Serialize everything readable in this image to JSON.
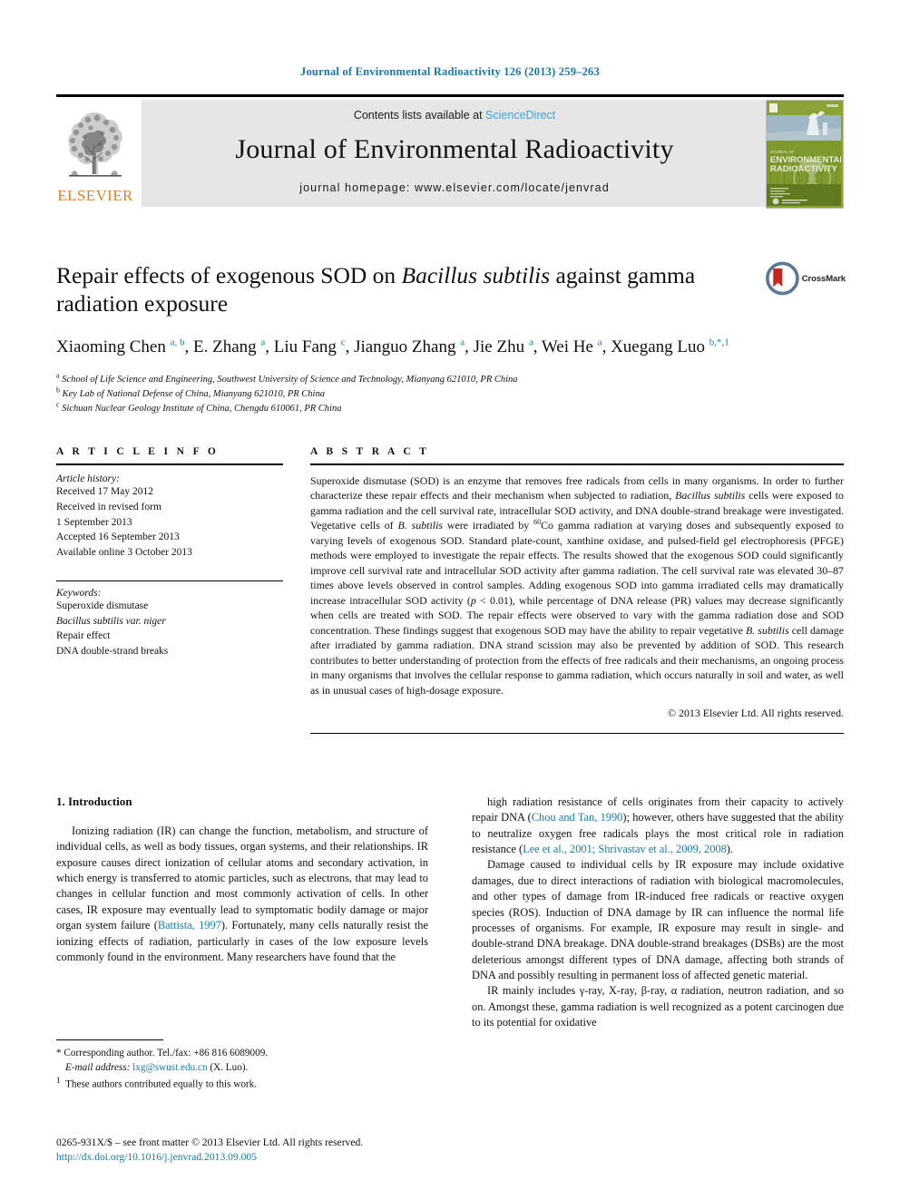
{
  "running_head": "Journal of Environmental Radioactivity 126 (2013) 259–263",
  "masthead": {
    "publisher_name": "ELSEVIER",
    "contents_prefix": "Contents lists available at",
    "contents_link": "ScienceDirect",
    "journal_title": "Journal of Environmental Radioactivity",
    "homepage": "journal homepage: www.elsevier.com/locate/jenvrad",
    "cover_title_line1": "JOURNAL OF",
    "cover_title_line2": "ENVIRONMENTAL",
    "cover_title_line3": "RADIOACTIVITY"
  },
  "badge": {
    "crossmark_label": "CrossMark"
  },
  "article": {
    "title_part1": "Repair effects of exogenous SOD on ",
    "title_italic": "Bacillus subtilis",
    "title_part2": " against gamma radiation exposure",
    "authors_html": "Xiaoming Chen <sup>a, b</sup>, E. Zhang <sup>a</sup>, Liu Fang <sup>c</sup>, Jianguo Zhang <sup>a</sup>, Jie Zhu <sup>a</sup>, Wei He <sup>a</sup>, Xuegang Luo <sup>b,&#42;,1</sup>",
    "affiliations": [
      "School of Life Science and Engineering, Southwest University of Science and Technology, Mianyang 621010, PR China",
      "Key Lab of National Defense of China, Mianyang 621010, PR China",
      "Sichuan Nuclear Geology Institute of China, Chengdu 610061, PR China"
    ],
    "affiliation_marks": [
      "a",
      "b",
      "c"
    ]
  },
  "article_info": {
    "heading": "A R T I C L E   I N F O",
    "history_label": "Article history:",
    "history": [
      "Received 17 May 2012",
      "Received in revised form",
      "1 September 2013",
      "Accepted 16 September 2013",
      "Available online 3 October 2013"
    ],
    "keywords_label": "Keywords:",
    "keywords": [
      "Superoxide dismutase",
      "Bacillus subtilis var. niger",
      "Repair effect",
      "DNA double-strand breaks"
    ]
  },
  "abstract": {
    "heading": "A B S T R A C T",
    "text_html": "Superoxide dismutase (SOD) is an enzyme that removes free radicals from cells in many organisms. In order to further characterize these repair effects and their mechanism when subjected to radiation, <i>Bacillus subtilis</i> cells were exposed to gamma radiation and the cell survival rate, intracellular SOD activity, and DNA double-strand breakage were investigated. Vegetative cells of <i>B. subtilis</i> were irradiated by <sup>60</sup>Co gamma radiation at varying doses and subsequently exposed to varying levels of exogenous SOD. Standard plate-count, xanthine oxidase, and pulsed-field gel electrophoresis (PFGE) methods were employed to investigate the repair effects. The results showed that the exogenous SOD could significantly improve cell survival rate and intracellular SOD activity after gamma radiation. The cell survival rate was elevated 30&#8211;87 times above levels observed in control samples. Adding exogenous SOD into gamma irradiated cells may dramatically increase intracellular SOD activity (<i>p</i> &lt; 0.01), while percentage of DNA release (PR) values may decrease significantly when cells are treated with SOD. The repair effects were observed to vary with the gamma radiation dose and SOD concentration. These findings suggest that exogenous SOD may have the ability to repair vegetative <i>B. subtilis</i> cell damage after irradiated by gamma radiation. DNA strand scission may also be prevented by addition of SOD. This research contributes to better understanding of protection from the effects of free radicals and their mechanisms, an ongoing process in many organisms that involves the cellular response to gamma radiation, which occurs naturally in soil and water, as well as in unusual cases of high-dosage exposure.",
    "copyright": "© 2013 Elsevier Ltd. All rights reserved."
  },
  "introduction": {
    "heading": "1. Introduction",
    "left_paragraphs_html": [
      "Ionizing radiation (IR) can change the function, metabolism, and structure of individual cells, as well as body tissues, organ systems, and their relationships. IR exposure causes direct ionization of cellular atoms and secondary activation, in which energy is transferred to atomic particles, such as electrons, that may lead to changes in cellular function and most commonly activation of cells. In other cases, IR exposure may eventually lead to symptomatic bodily damage or major organ system failure (<a class=\"cite\" href=\"#\">Battista, 1997</a>). Fortunately, many cells naturally resist the ionizing effects of radiation, particularly in cases of the low exposure levels commonly found in the environment. Many researchers have found that the"
    ],
    "right_paragraphs_html": [
      "high radiation resistance of cells originates from their capacity to actively repair DNA (<a class=\"cite\" href=\"#\">Chou and Tan, 1990</a>); however, others have suggested that the ability to neutralize oxygen free radicals plays the most critical role in radiation resistance (<a class=\"cite\" href=\"#\">Lee et al., 2001; Shrivastav et al., 2009, 2008</a>).",
      "Damage caused to individual cells by IR exposure may include oxidative damages, due to direct interactions of radiation with biological macromolecules, and other types of damage from IR-induced free radicals or reactive oxygen species (ROS). Induction of DNA damage by IR can influence the normal life processes of organisms. For example, IR exposure may result in single- and double-strand DNA breakage. DNA double-strand breakages (DSBs) are the most deleterious amongst different types of DNA damage, affecting both strands of DNA and possibly resulting in permanent loss of affected genetic material.",
      "IR mainly includes &#947;-ray, X-ray, &#946;-ray, &#945; radiation, neutron radiation, and so on. Amongst these, gamma radiation is well recognized as a potent carcinogen due to its potential for oxidative"
    ]
  },
  "footnotes": {
    "corresponding_html": "* Corresponding author. Tel./fax: +86 816 6089009.",
    "email_label": "E-mail address:",
    "email": "lxg@swust.edu.cn",
    "email_suffix": "(X. Luo).",
    "equal_contribution_html": "<sup>1</sup>&nbsp; These authors contributed equally to this work."
  },
  "colophon": {
    "issn_line": "0265-931X/$ – see front matter © 2013 Elsevier Ltd. All rights reserved.",
    "doi": "http://dx.doi.org/10.1016/j.jenvrad.2013.09.005"
  },
  "colors": {
    "link_blue": "#1879a8",
    "sciencedirect_blue": "#3aa7dd",
    "elsevier_orange": "#e87d1e",
    "band_gray": "#e6e6e6",
    "crossmark_red": "#c3281f",
    "crossmark_ring": "#5a7a96"
  }
}
